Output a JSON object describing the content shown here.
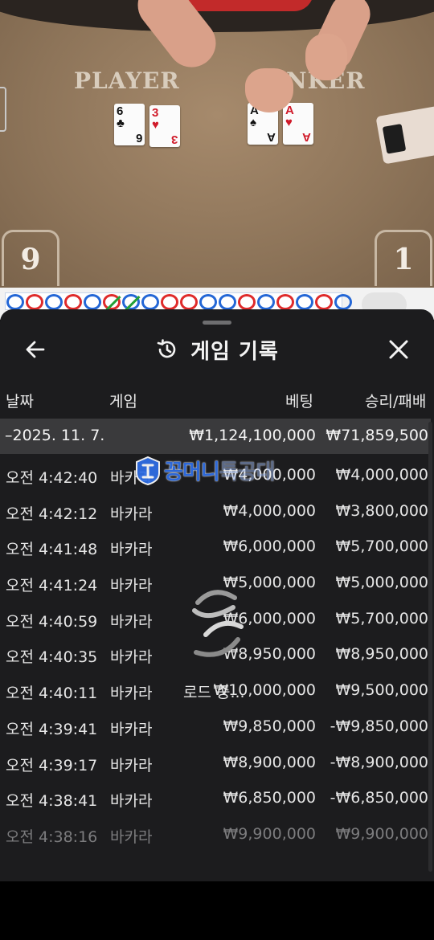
{
  "video": {
    "player_label": "PLAYER",
    "banker_label": "NKER",
    "player_score": "9",
    "banker_score": "1",
    "player_cards": [
      {
        "rank": "6",
        "suit": "♣",
        "color": "black"
      },
      {
        "rank": "3",
        "suit": "♥",
        "color": "red"
      }
    ],
    "banker_cards": [
      {
        "rank": "A",
        "suit": "♠",
        "color": "black"
      },
      {
        "rank": "A",
        "suit": "♥",
        "color": "red"
      }
    ]
  },
  "road": {
    "beads": [
      "blue",
      "red",
      "blue",
      "red",
      "blue",
      "red-tie",
      "blue-tie",
      "blue",
      "red",
      "red",
      "blue",
      "blue",
      "red",
      "blue",
      "red",
      "blue",
      "red",
      "blue"
    ]
  },
  "sheet": {
    "title": "게임 기록",
    "back_icon": "arrow-left-icon",
    "close_icon": "close-icon",
    "history_icon": "history-icon",
    "columns": {
      "date": "날짜",
      "game": "게임",
      "bet": "베팅",
      "result": "승리/패배"
    },
    "summary": {
      "date": "–2025. 11. 7.",
      "bet": "₩1,124,100,000",
      "result": "₩71,859,500"
    },
    "rows": [
      {
        "time": "오전 4:42:40",
        "game": "바카라",
        "bet": "₩4,000,000",
        "result": "₩4,000,000"
      },
      {
        "time": "오전 4:42:12",
        "game": "바카라",
        "bet": "₩4,000,000",
        "result": "₩3,800,000"
      },
      {
        "time": "오전 4:41:48",
        "game": "바카라",
        "bet": "₩6,000,000",
        "result": "₩5,700,000"
      },
      {
        "time": "오전 4:41:24",
        "game": "바카라",
        "bet": "₩5,000,000",
        "result": "₩5,000,000"
      },
      {
        "time": "오전 4:40:59",
        "game": "바카라",
        "bet": "₩6,000,000",
        "result": "₩5,700,000"
      },
      {
        "time": "오전 4:40:35",
        "game": "바카라",
        "bet": "₩8,950,000",
        "result": "₩8,950,000"
      },
      {
        "time": "오전 4:40:11",
        "game": "바카라",
        "bet": "₩10,000,000",
        "result": "₩9,500,000"
      },
      {
        "time": "오전 4:39:41",
        "game": "바카라",
        "bet": "₩9,850,000",
        "result": "-₩9,850,000"
      },
      {
        "time": "오전 4:39:17",
        "game": "바카라",
        "bet": "₩8,900,000",
        "result": "-₩8,900,000"
      },
      {
        "time": "오전 4:38:41",
        "game": "바카라",
        "bet": "₩6,850,000",
        "result": "-₩6,850,000"
      },
      {
        "time": "오전 4:38:16",
        "game": "바카라",
        "bet": "₩9,900,000",
        "result": "₩9,900,000"
      }
    ],
    "loading_text": "로드 중..."
  },
  "watermark": {
    "text_main": "꽁머니",
    "text_faded": "특공대"
  },
  "colors": {
    "sheet_bg": "#1c1c1e",
    "summary_bg": "#3a3a3c",
    "player_blue": "#2467d6",
    "banker_red": "#df2b2b",
    "tie_green": "#23a036"
  }
}
